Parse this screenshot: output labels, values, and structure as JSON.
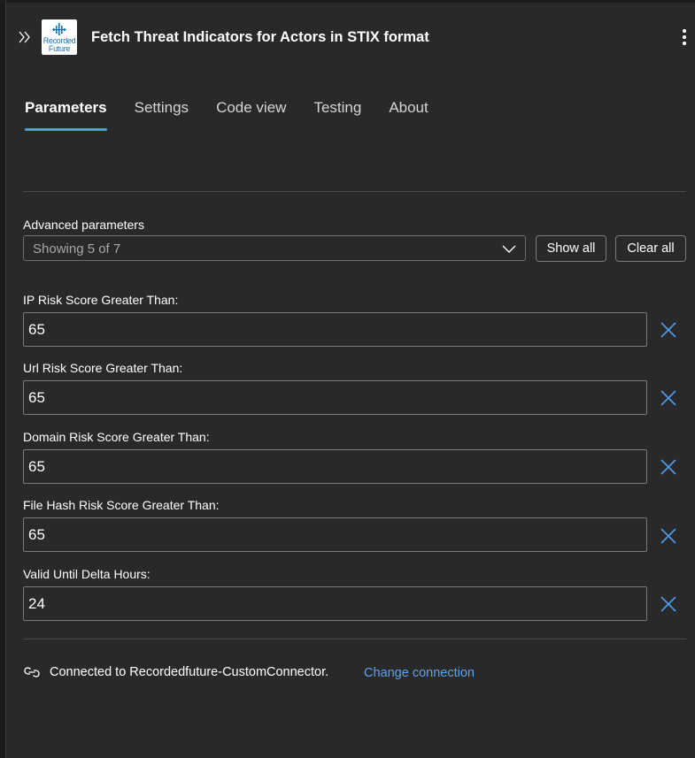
{
  "header": {
    "title": "Fetch Threat Indicators for Actors in STIX format",
    "logo_line1": "Recorded",
    "logo_line2": "Future"
  },
  "tabs": [
    {
      "label": "Parameters",
      "active": true
    },
    {
      "label": "Settings",
      "active": false
    },
    {
      "label": "Code view",
      "active": false
    },
    {
      "label": "Testing",
      "active": false
    },
    {
      "label": "About",
      "active": false
    }
  ],
  "advanced": {
    "label": "Advanced parameters",
    "selected": "Showing 5 of 7",
    "show_all": "Show all",
    "clear_all": "Clear all"
  },
  "params": [
    {
      "label": "IP Risk Score Greater Than:",
      "value": "65"
    },
    {
      "label": "Url Risk Score Greater Than:",
      "value": "65"
    },
    {
      "label": "Domain Risk Score Greater Than:",
      "value": "65"
    },
    {
      "label": "File Hash Risk Score Greater Than:",
      "value": "65"
    },
    {
      "label": "Valid Until Delta Hours:",
      "value": "24"
    }
  ],
  "connection": {
    "text": "Connected to Recordedfuture-CustomConnector.",
    "change_link": "Change connection"
  },
  "colors": {
    "background": "#292929",
    "accent": "#4f9be9",
    "link": "#5aa3f0",
    "logo_blue": "#1b6fb3"
  },
  "icons": {
    "expand": "double-chevron-right-icon",
    "more": "more-vertical-icon",
    "chevron": "chevron-down-icon",
    "remove": "close-icon",
    "connection": "link-icon"
  }
}
